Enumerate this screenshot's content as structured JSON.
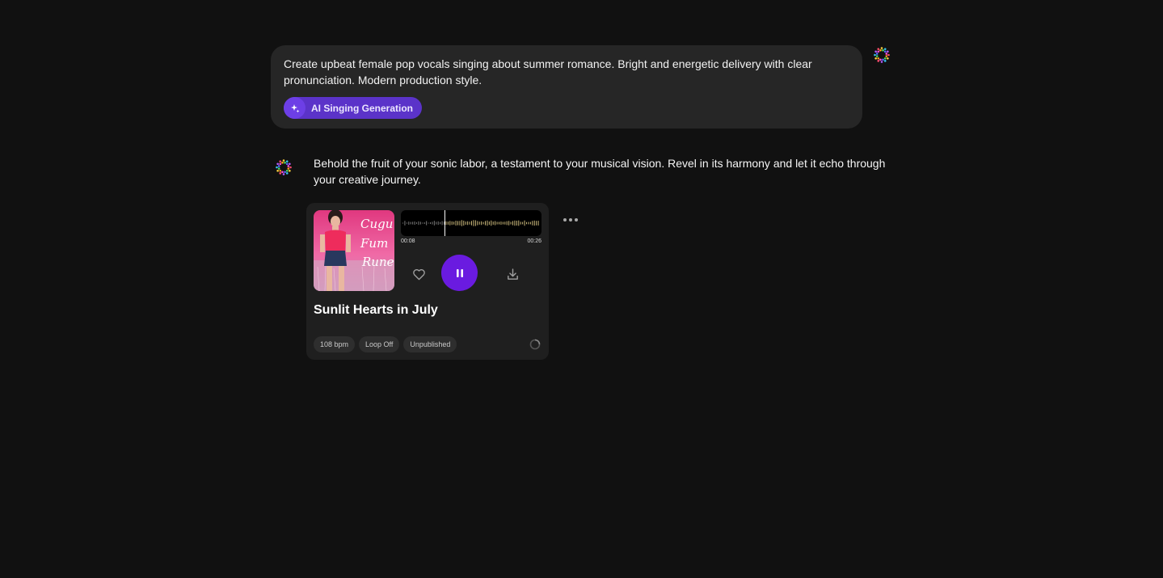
{
  "user_message": {
    "text": "Create upbeat female pop vocals singing about summer romance. Bright and energetic delivery with clear pronunciation. Modern production style.",
    "tag": {
      "label": "AI Singing Generation",
      "icon": "sparkle-icon"
    }
  },
  "ai_message": {
    "text": "Behold the fruit of your sonic labor, a testament to your musical vision. Revel in its harmony and let it echo through your creative journey."
  },
  "track": {
    "title": "Sunlit Hearts in July",
    "current_time": "00:08",
    "duration": "00:26",
    "progress": 0.31,
    "state": "playing",
    "chips": [
      "108 bpm",
      "Loop Off",
      "Unpublished"
    ],
    "cover_text": [
      "Cugu",
      "Fum",
      "Rune"
    ]
  },
  "colors": {
    "background": "#111111",
    "accent": "#6a1be0",
    "tag": "#5b33c9",
    "waveform": "#c9b77a"
  }
}
